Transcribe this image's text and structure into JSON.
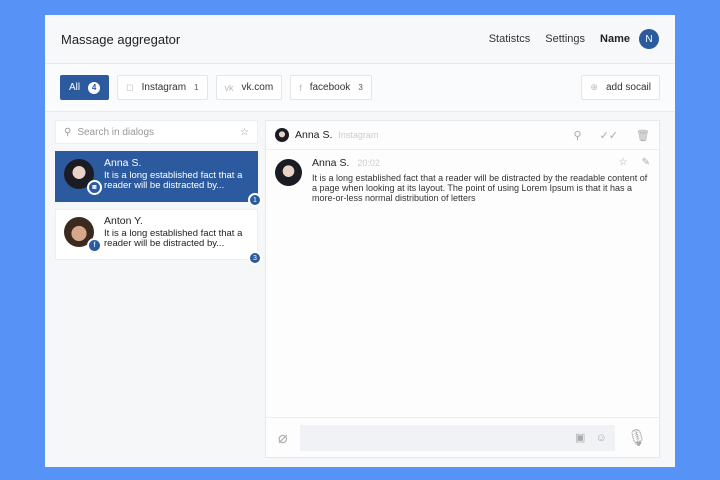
{
  "header": {
    "title": "Massage aggregator",
    "nav": [
      "Statistcs",
      "Settings"
    ],
    "user_name": "Name",
    "user_initial": "N"
  },
  "filters": [
    {
      "label": "All",
      "count": "4"
    },
    {
      "label": "Instagram",
      "count": "1"
    },
    {
      "label": "vk.com"
    },
    {
      "label": "facebook",
      "count": "3"
    }
  ],
  "add_social": "add socail",
  "search": {
    "placeholder": "Search in dialogs"
  },
  "dialogs": [
    {
      "name": "Anna S.",
      "preview": "It is a long established fact that a reader will be distracted by...",
      "unread": "1",
      "network": "instagram"
    },
    {
      "name": "Anton Y.",
      "preview": "It is a long established fact that a reader will be distracted by...",
      "unread": "3",
      "network": "facebook"
    }
  ],
  "chat": {
    "name": "Anna S.",
    "network": "Instagram",
    "messages": [
      {
        "author": "Anna S.",
        "time": "20:02",
        "text": "It is a long established fact that a reader will be distracted by the readable content of a page when looking at its layout. The point of using Lorem Ipsum is that it has a more-or-less normal distribution of letters"
      }
    ]
  },
  "colors": {
    "accent": "#2b5a9e",
    "background": "#5793f6"
  }
}
